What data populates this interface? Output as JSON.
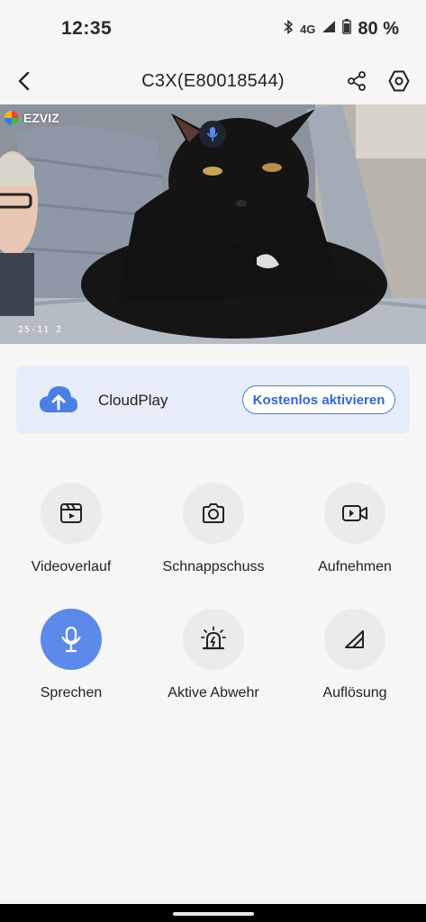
{
  "status_bar": {
    "time": "12:35",
    "network": "4G",
    "battery": "80 %",
    "icons": [
      "bluetooth-icon",
      "signal-icon",
      "battery-icon"
    ]
  },
  "header": {
    "title": "C3X(E80018544)",
    "icons": [
      "back-arrow-icon",
      "share-icon",
      "settings-hexagon-icon"
    ]
  },
  "video": {
    "logo_text": "EZVIZ",
    "timestamp": "25-11   2",
    "mic_icon": "microphone-icon"
  },
  "cloud": {
    "label": "CloudPlay",
    "button": "Kostenlos aktivieren",
    "icon": "cloud-upload-icon",
    "accent": "#4c7be6",
    "background": "#e6ecf8"
  },
  "actions": [
    {
      "label": "Videoverlauf",
      "icon": "video-history-icon",
      "active": false
    },
    {
      "label": "Schnappschuss",
      "icon": "camera-icon",
      "active": false
    },
    {
      "label": "Aufnehmen",
      "icon": "video-record-icon",
      "active": false
    },
    {
      "label": "Sprechen",
      "icon": "microphone-icon",
      "active": true
    },
    {
      "label": "Aktive Abwehr",
      "icon": "alarm-light-icon",
      "active": false
    },
    {
      "label": "Auflösung",
      "icon": "resolution-icon",
      "active": false
    }
  ],
  "colors": {
    "active_button": "#5b8aea",
    "button_bg": "#ebebee",
    "page_bg": "#f6f6f7"
  }
}
